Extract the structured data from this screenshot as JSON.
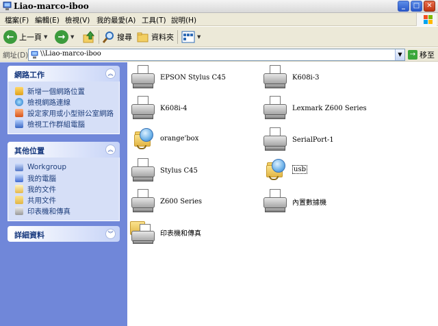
{
  "window": {
    "title": "Liao-marco-iboo",
    "controls": {
      "minimize": "_",
      "maximize": "□",
      "close": "✕"
    }
  },
  "menu": {
    "items": [
      "檔案(F)",
      "編輯(E)",
      "檢視(V)",
      "我的最愛(A)",
      "工具(T)",
      "說明(H)"
    ]
  },
  "toolbar": {
    "back_label": "上一頁",
    "search_label": "搜尋",
    "folders_label": "資料夾"
  },
  "address": {
    "label": "網址(D)",
    "value": "\\\\Liao-marco-iboo",
    "go_label": "移至"
  },
  "left_pane": {
    "network_tasks": {
      "title": "網路工作",
      "items": [
        "新增一個網路位置",
        "檢視網路連線",
        "設定家用或小型辦公室網路",
        "檢視工作群組電腦"
      ]
    },
    "other_places": {
      "title": "其他位置",
      "items": [
        "Workgroup",
        "我的電腦",
        "我的文件",
        "共用文件",
        "印表機和傳真"
      ]
    },
    "details": {
      "title": "詳細資料"
    }
  },
  "items": [
    {
      "label": "EPSON Stylus C45",
      "icon": "printer-icon"
    },
    {
      "label": "K608i-3",
      "icon": "printer-icon"
    },
    {
      "label": "K608i-4",
      "icon": "printer-icon"
    },
    {
      "label": "Lexmark  Z600 Series",
      "icon": "printer-icon"
    },
    {
      "label": "orange'box",
      "icon": "shared-folder-icon"
    },
    {
      "label": "SerialPort-1",
      "icon": "printer-icon"
    },
    {
      "label": "Stylus C45",
      "icon": "printer-icon"
    },
    {
      "label": "usb",
      "icon": "shared-folder-icon"
    },
    {
      "label": "Z600 Series",
      "icon": "printer-icon"
    },
    {
      "label": "內置數據機",
      "icon": "printer-icon"
    },
    {
      "label": "印表機和傳真",
      "icon": "printer-folder-icon"
    }
  ]
}
